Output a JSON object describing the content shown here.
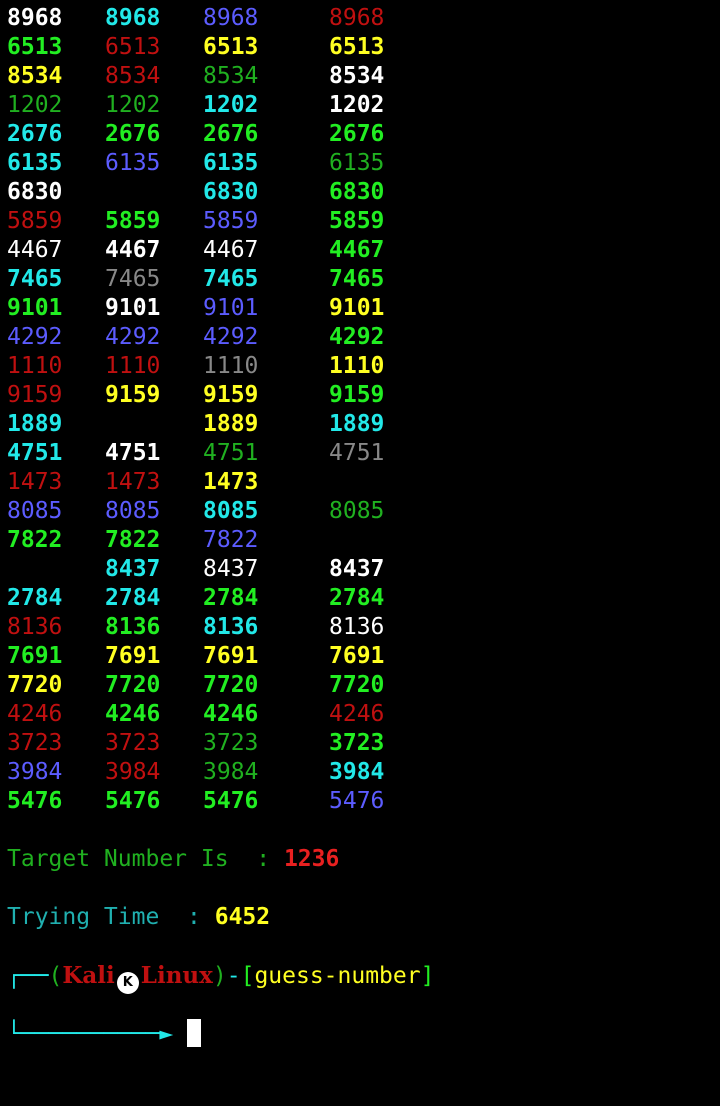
{
  "rows": [
    [
      [
        "8968",
        "W"
      ],
      [
        "8968",
        "C"
      ],
      [
        "8968",
        "B"
      ],
      [
        "8968",
        "r"
      ]
    ],
    [
      [
        "6513",
        "G"
      ],
      [
        "6513",
        "r"
      ],
      [
        "6513",
        "Y"
      ],
      [
        "6513",
        "Y"
      ]
    ],
    [
      [
        "8534",
        "Y"
      ],
      [
        "8534",
        "r"
      ],
      [
        "8534",
        "g"
      ],
      [
        "8534",
        "W"
      ]
    ],
    [
      [
        "1202",
        "g"
      ],
      [
        "1202",
        "g"
      ],
      [
        "1202",
        "C"
      ],
      [
        "1202",
        "W"
      ]
    ],
    [
      [
        "2676",
        "C"
      ],
      [
        "2676",
        "G"
      ],
      [
        "2676",
        "G"
      ],
      [
        "2676",
        "G"
      ]
    ],
    [
      [
        "6135",
        "C"
      ],
      [
        "6135",
        "B"
      ],
      [
        "6135",
        "C"
      ],
      [
        "6135",
        "g"
      ]
    ],
    [
      [
        "6830",
        "W"
      ],
      [
        "",
        ""
      ],
      [
        "6830",
        "C"
      ],
      [
        "6830",
        "G"
      ]
    ],
    [
      [
        "5859",
        "r"
      ],
      [
        "5859",
        "G"
      ],
      [
        "5859",
        "B"
      ],
      [
        "5859",
        "G"
      ]
    ],
    [
      [
        "4467",
        "w"
      ],
      [
        "4467",
        "W"
      ],
      [
        "4467",
        "w"
      ],
      [
        "4467",
        "G"
      ]
    ],
    [
      [
        "7465",
        "C"
      ],
      [
        "7465",
        "K"
      ],
      [
        "7465",
        "C"
      ],
      [
        "7465",
        "G"
      ]
    ],
    [
      [
        "9101",
        "G"
      ],
      [
        "9101",
        "W"
      ],
      [
        "9101",
        "B"
      ],
      [
        "9101",
        "Y"
      ]
    ],
    [
      [
        "4292",
        "B"
      ],
      [
        "4292",
        "B"
      ],
      [
        "4292",
        "B"
      ],
      [
        "4292",
        "G"
      ]
    ],
    [
      [
        "1110",
        "r"
      ],
      [
        "1110",
        "r"
      ],
      [
        "1110",
        "K"
      ],
      [
        "1110",
        "Y"
      ]
    ],
    [
      [
        "9159",
        "r"
      ],
      [
        "9159",
        "Y"
      ],
      [
        "9159",
        "Y"
      ],
      [
        "9159",
        "G"
      ]
    ],
    [
      [
        "1889",
        "C"
      ],
      [
        "",
        ""
      ],
      [
        "1889",
        "Y"
      ],
      [
        "1889",
        "C"
      ]
    ],
    [
      [
        "4751",
        "C"
      ],
      [
        "4751",
        "W"
      ],
      [
        "4751",
        "g"
      ],
      [
        "4751",
        "K"
      ]
    ],
    [
      [
        "1473",
        "r"
      ],
      [
        "1473",
        "r"
      ],
      [
        "1473",
        "Y"
      ],
      [
        "",
        ""
      ]
    ],
    [
      [
        "8085",
        "B"
      ],
      [
        "8085",
        "B"
      ],
      [
        "8085",
        "C"
      ],
      [
        "8085",
        "g"
      ]
    ],
    [
      [
        "7822",
        "G"
      ],
      [
        "7822",
        "G"
      ],
      [
        "7822",
        "B"
      ],
      [
        "",
        ""
      ]
    ],
    [
      [
        "",
        ""
      ],
      [
        "8437",
        "C"
      ],
      [
        "8437",
        "w"
      ],
      [
        "8437",
        "W"
      ]
    ],
    [
      [
        "2784",
        "C"
      ],
      [
        "2784",
        "C"
      ],
      [
        "2784",
        "G"
      ],
      [
        "2784",
        "G"
      ]
    ],
    [
      [
        "8136",
        "r"
      ],
      [
        "8136",
        "G"
      ],
      [
        "8136",
        "C"
      ],
      [
        "8136",
        "w"
      ]
    ],
    [
      [
        "7691",
        "G"
      ],
      [
        "7691",
        "Y"
      ],
      [
        "7691",
        "Y"
      ],
      [
        "7691",
        "Y"
      ]
    ],
    [
      [
        "7720",
        "Y"
      ],
      [
        "7720",
        "G"
      ],
      [
        "7720",
        "G"
      ],
      [
        "7720",
        "G"
      ]
    ],
    [
      [
        "4246",
        "r"
      ],
      [
        "4246",
        "G"
      ],
      [
        "4246",
        "G"
      ],
      [
        "4246",
        "r"
      ]
    ],
    [
      [
        "3723",
        "r"
      ],
      [
        "3723",
        "r"
      ],
      [
        "3723",
        "g"
      ],
      [
        "3723",
        "G"
      ]
    ],
    [
      [
        "3984",
        "B"
      ],
      [
        "3984",
        "r"
      ],
      [
        "3984",
        "g"
      ],
      [
        "3984",
        "C"
      ]
    ],
    [
      [
        "5476",
        "G"
      ],
      [
        "5476",
        "G"
      ],
      [
        "5476",
        "G"
      ],
      [
        "5476",
        "B"
      ]
    ]
  ],
  "colors": {
    "W": "#ffffff",
    "w": "#ffffff",
    "C": "#22e8e8",
    "B": "#5c5cff",
    "r": "#c01010",
    "G": "#22ee22",
    "g": "#20b020",
    "Y": "#ffff22",
    "K": "#888888"
  },
  "target": {
    "label": "Target Number Is  : ",
    "value": "1236"
  },
  "trying": {
    "label": "Trying Time  : ",
    "value": "6452"
  },
  "prompt": {
    "corner": "┌──",
    "open_paren": "(",
    "host_a": "Kali",
    "logo": "K",
    "host_b": "Linux",
    "close_paren": ")",
    "dash": "-",
    "open_bracket": "[",
    "directory": "guess-number",
    "close_bracket": "]",
    "arrow": "└──────────►"
  }
}
